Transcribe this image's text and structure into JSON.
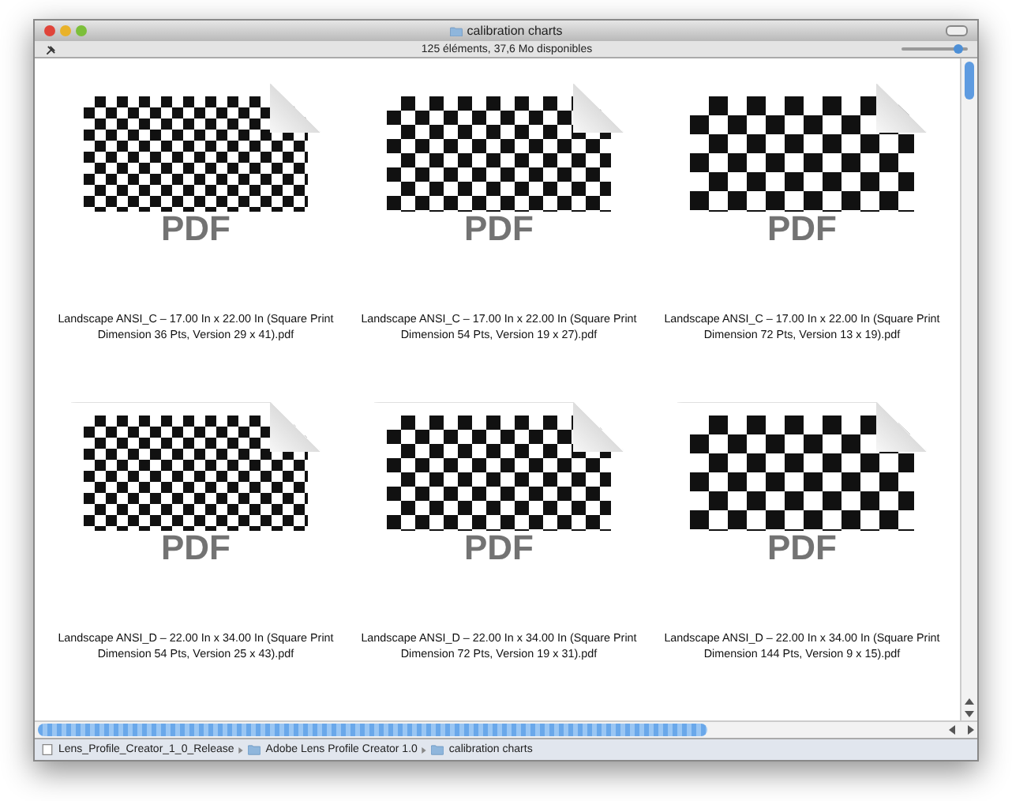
{
  "window": {
    "title": "calibration charts"
  },
  "status": "125 éléments, 37,6 Mo disponibles",
  "icon_size_slider": {
    "level": 0.85
  },
  "files": [
    {
      "name": "Landscape ANSI_C – 17.00 In x 22.00 In (Square Print Dimension 36 Pts, Version 29 x 41).pdf",
      "badge": "PDF",
      "kind": "fine"
    },
    {
      "name": "Landscape ANSI_C – 17.00 In x 22.00 In (Square Print Dimension 54 Pts, Version 19 x 27).pdf",
      "badge": "PDF",
      "kind": "medium"
    },
    {
      "name": "Landscape ANSI_C – 17.00 In x 22.00 In (Square Print Dimension 72 Pts, Version 13 x 19).pdf",
      "badge": "PDF",
      "kind": "coarse"
    },
    {
      "name": "Landscape ANSI_D – 22.00 In x 34.00 In (Square Print Dimension 54 Pts, Version 25 x 43).pdf",
      "badge": "PDF",
      "kind": "fine"
    },
    {
      "name": "Landscape ANSI_D – 22.00 In x 34.00 In (Square Print Dimension 72 Pts, Version 19 x 31).pdf",
      "badge": "PDF",
      "kind": "medium"
    },
    {
      "name": "Landscape ANSI_D – 22.00 In x 34.00 In (Square Print Dimension 144 Pts, Version 9 x 15).pdf",
      "badge": "PDF",
      "kind": "coarse"
    }
  ],
  "path": [
    {
      "label": "Lens_Profile_Creator_1_0_Release",
      "kind": "file"
    },
    {
      "label": "Adobe Lens Profile Creator 1.0",
      "kind": "folder"
    },
    {
      "label": "calibration charts",
      "kind": "folder"
    }
  ]
}
